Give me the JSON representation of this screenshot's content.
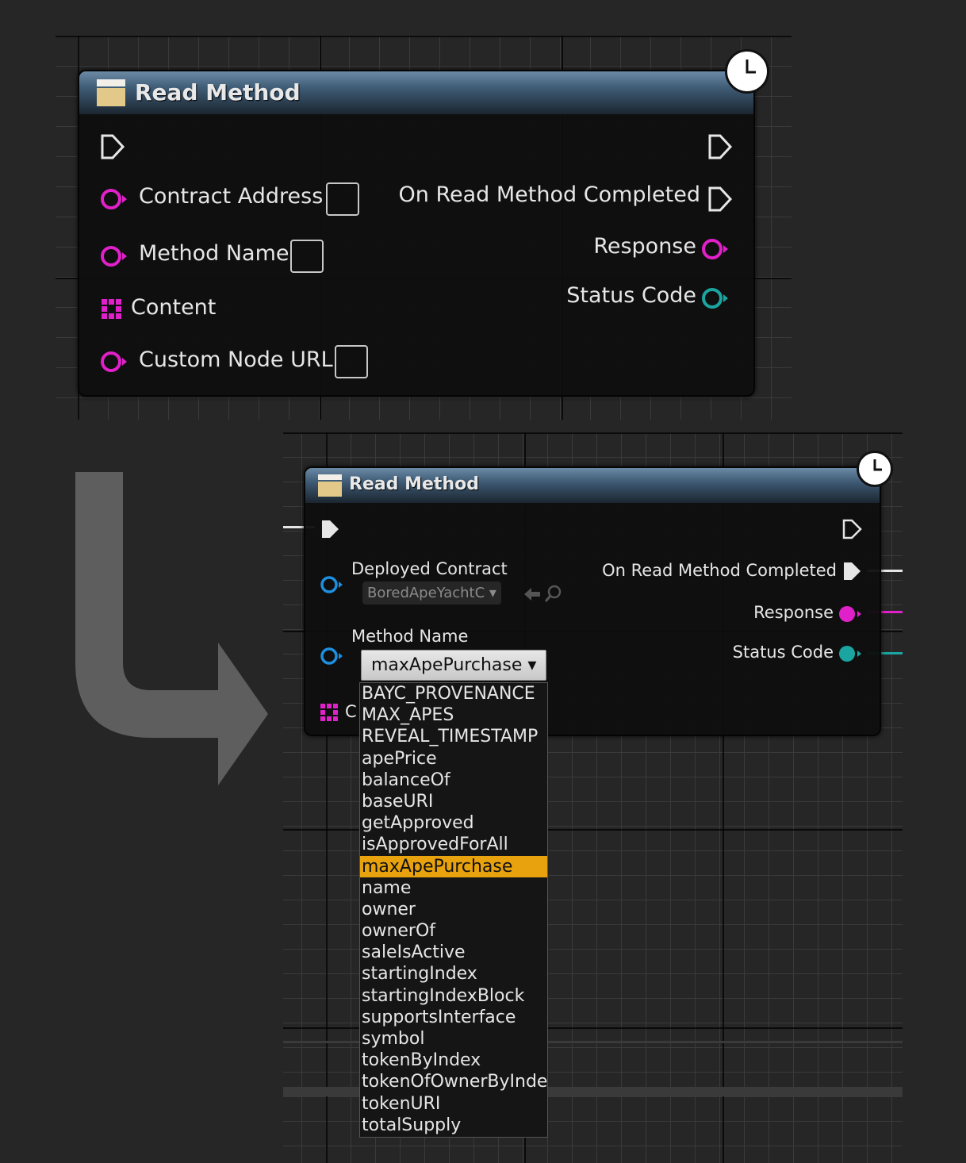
{
  "top_node": {
    "title": "Read Method",
    "inputs": {
      "contract_address": "Contract Address",
      "method_name": "Method Name",
      "content": "Content",
      "custom_node_url": "Custom Node URL"
    },
    "outputs": {
      "on_completed": "On Read Method Completed",
      "response": "Response",
      "status_code": "Status Code"
    }
  },
  "bottom_node": {
    "title": "Read Method",
    "inputs": {
      "deployed_contract": "Deployed Contract",
      "deployed_contract_value": "BoredApeYachtC",
      "method_name": "Method Name",
      "method_name_value": "maxApePurchase",
      "content_partial": "C"
    },
    "outputs": {
      "on_completed": "On Read Method Completed",
      "response": "Response",
      "status_code": "Status Code"
    }
  },
  "dropdown": {
    "selected": "maxApePurchase",
    "options": [
      "BAYC_PROVENANCE",
      "MAX_APES",
      "REVEAL_TIMESTAMP",
      "apePrice",
      "balanceOf",
      "baseURI",
      "getApproved",
      "isApprovedForAll",
      "maxApePurchase",
      "name",
      "owner",
      "ownerOf",
      "saleIsActive",
      "startingIndex",
      "startingIndexBlock",
      "supportsInterface",
      "symbol",
      "tokenByIndex",
      "tokenOfOwnerByIndex",
      "tokenURI",
      "totalSupply"
    ]
  },
  "colors": {
    "string_pin": "#e020c8",
    "object_pin": "#1e8fe0",
    "int_pin": "#1aa5a0",
    "selected_item": "#e7a20e",
    "header": "#3e5a74"
  }
}
